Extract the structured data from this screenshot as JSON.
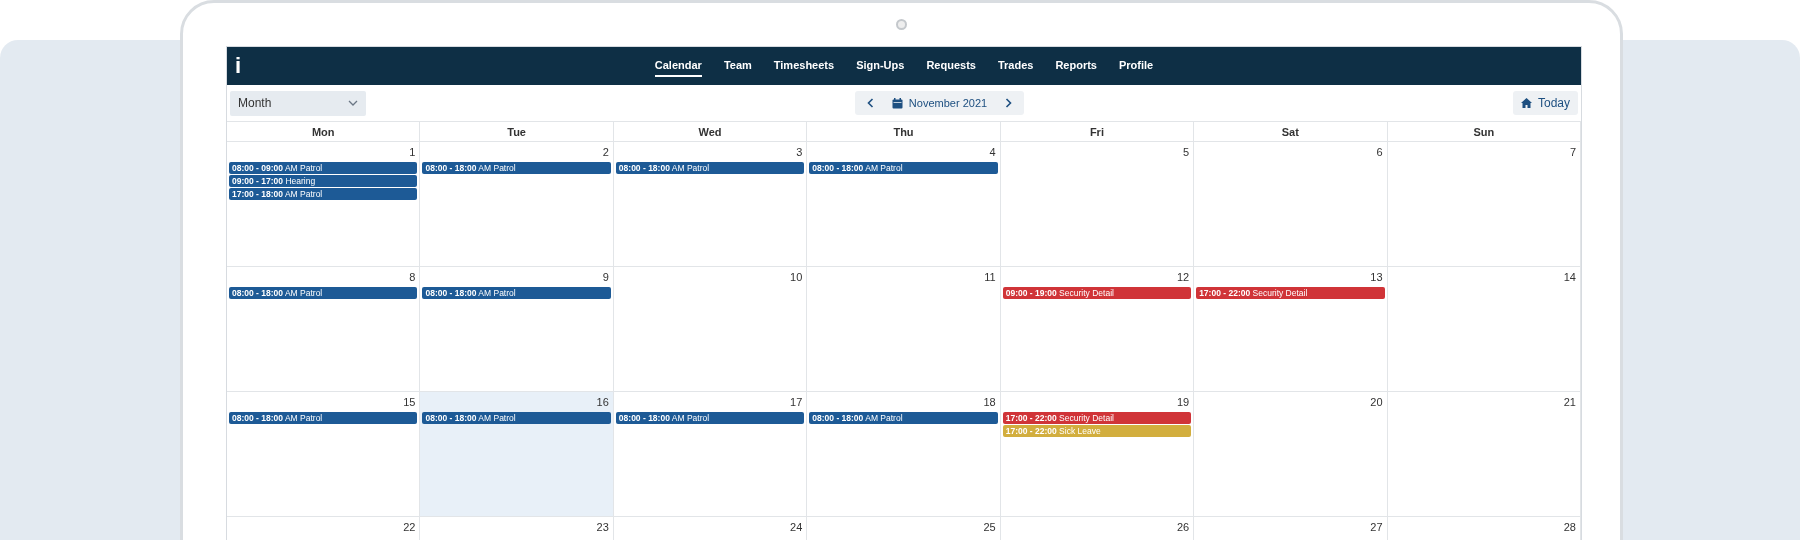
{
  "nav": {
    "logo": "i",
    "items": [
      {
        "label": "Calendar",
        "selected": true
      },
      {
        "label": "Team",
        "selected": false
      },
      {
        "label": "Timesheets",
        "selected": false
      },
      {
        "label": "Sign-Ups",
        "selected": false
      },
      {
        "label": "Requests",
        "selected": false
      },
      {
        "label": "Trades",
        "selected": false
      },
      {
        "label": "Reports",
        "selected": false
      },
      {
        "label": "Profile",
        "selected": false
      }
    ]
  },
  "toolbar": {
    "view": "Month",
    "month": "November 2021",
    "today": "Today"
  },
  "weekdays": [
    "Mon",
    "Tue",
    "Wed",
    "Thu",
    "Fri",
    "Sat",
    "Sun"
  ],
  "weeks": [
    {
      "days": [
        {
          "day": "1",
          "selected": false,
          "events": [
            {
              "text": "**08:00 - 09:00** AM Patrol",
              "color": "#1d5a96"
            },
            {
              "text": "**09:00 - 17:00** Hearing",
              "color": "#1d5a96"
            },
            {
              "text": "**17:00 - 18:00** AM Patrol",
              "color": "#1d5a96"
            }
          ]
        },
        {
          "day": "2",
          "selected": false,
          "events": [
            {
              "text": "**08:00 - 18:00** AM Patrol",
              "color": "#1d5a96"
            }
          ]
        },
        {
          "day": "3",
          "selected": false,
          "events": [
            {
              "text": "**08:00 - 18:00** AM Patrol",
              "color": "#1d5a96"
            }
          ]
        },
        {
          "day": "4",
          "selected": false,
          "events": [
            {
              "text": "**08:00 - 18:00** AM Patrol",
              "color": "#1d5a96"
            }
          ]
        },
        {
          "day": "5",
          "selected": false
        },
        {
          "day": "6",
          "selected": false
        },
        {
          "day": "7",
          "selected": false
        }
      ]
    },
    {
      "days": [
        {
          "day": "8",
          "selected": false,
          "events": [
            {
              "text": "**08:00 - 18:00** AM Patrol",
              "color": "#1d5a96"
            }
          ]
        },
        {
          "day": "9",
          "selected": false,
          "events": [
            {
              "text": "**08:00 - 18:00** AM Patrol",
              "color": "#1d5a96"
            }
          ]
        },
        {
          "day": "10",
          "selected": false
        },
        {
          "day": "11",
          "selected": false
        },
        {
          "day": "12",
          "selected": false,
          "events": [
            {
              "text": "**09:00 - 19:00** Security Detail",
              "color": "#d03438"
            }
          ]
        },
        {
          "day": "13",
          "selected": false,
          "events": [
            {
              "text": "**17:00 - 22:00** Security Detail",
              "color": "#d03438"
            }
          ]
        },
        {
          "day": "14",
          "selected": false
        }
      ]
    },
    {
      "days": [
        {
          "day": "15",
          "selected": false,
          "events": [
            {
              "text": "**08:00 - 18:00** AM Patrol",
              "color": "#1d5a96"
            }
          ]
        },
        {
          "day": "16",
          "selected": true,
          "events": [
            {
              "text": "**08:00 - 18:00** AM Patrol",
              "color": "#1d5a96"
            }
          ]
        },
        {
          "day": "17",
          "selected": false,
          "events": [
            {
              "text": "**08:00 - 18:00** AM Patrol",
              "color": "#1d5a96"
            }
          ]
        },
        {
          "day": "18",
          "selected": false,
          "events": [
            {
              "text": "**08:00 - 18:00** AM Patrol",
              "color": "#1d5a96"
            }
          ]
        },
        {
          "day": "19",
          "selected": false,
          "events": [
            {
              "text": "**17:00 - 22:00** Security Detail",
              "color": "#d03438"
            },
            {
              "text": "**17:00 - 22:00** Sick Leave",
              "color": "#d2ae3e"
            }
          ]
        },
        {
          "day": "20",
          "selected": false
        },
        {
          "day": "21",
          "selected": false
        }
      ]
    },
    {
      "days": [
        {
          "day": "22",
          "selected": false
        },
        {
          "day": "23",
          "selected": false
        },
        {
          "day": "24",
          "selected": false
        },
        {
          "day": "25",
          "selected": false
        },
        {
          "day": "26",
          "selected": false
        },
        {
          "day": "27",
          "selected": false
        },
        {
          "day": "28",
          "selected": false
        }
      ]
    }
  ]
}
